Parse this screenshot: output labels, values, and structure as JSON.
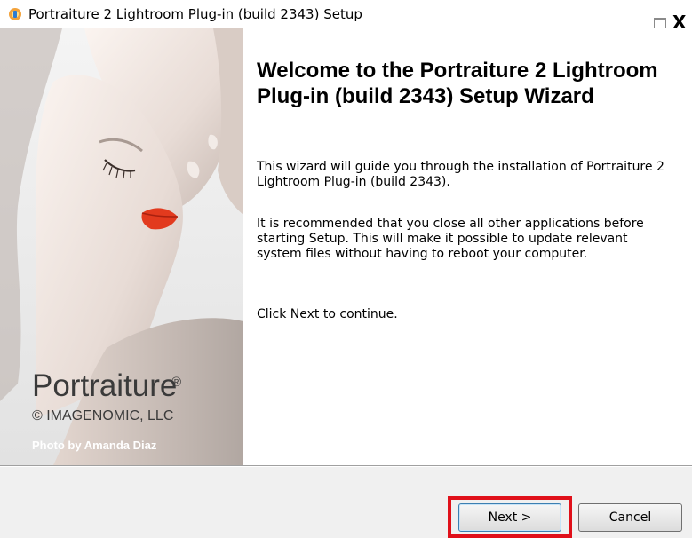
{
  "window": {
    "title": "Portraiture 2 Lightroom Plug-in (build 2343) Setup",
    "controls": {
      "minimize": "minimize",
      "maximize": "maximize",
      "close": "X"
    }
  },
  "sidebar_image": {
    "brand": "Portraiture",
    "registered": "®",
    "company": "© IMAGENOMIC, LLC",
    "credit": "Photo by Amanda Diaz"
  },
  "main": {
    "heading": "Welcome to the Portraiture 2 Lightroom Plug-in (build 2343) Setup Wizard",
    "paragraphs": [
      "This wizard will guide you through the installation of Portraiture 2 Lightroom Plug-in (build 2343).",
      "It is recommended that you close all other applications before starting Setup. This will make it possible to update relevant system files without having to reboot your computer.",
      "Click Next to continue."
    ]
  },
  "footer": {
    "next_label": "Next >",
    "cancel_label": "Cancel"
  },
  "colors": {
    "highlight": "#e0101a",
    "lip": "#e23a1e",
    "panel_bg": "#f0f0f0"
  },
  "icons": {
    "app": "installer-icon"
  }
}
